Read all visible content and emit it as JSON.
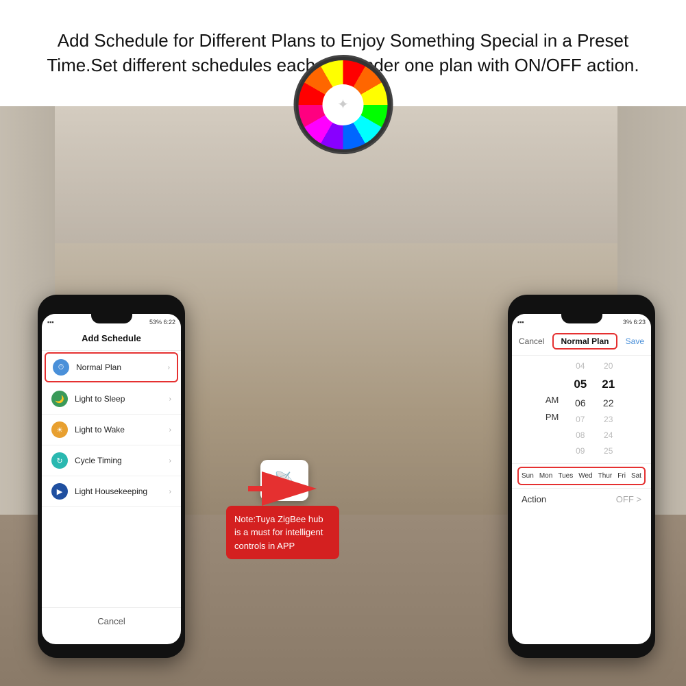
{
  "header": {
    "text": "Add Schedule for Different Plans to Enjoy Something Special in a Preset Time.Set different schedules each day under one plan with ON/OFF action."
  },
  "left_phone": {
    "status": "53%  6:22",
    "screen_title": "Add Schedule",
    "items": [
      {
        "id": "normal-plan",
        "icon": "clock",
        "icon_color": "blue",
        "label": "Normal Plan",
        "highlighted": true
      },
      {
        "id": "light-to-sleep",
        "icon": "moon",
        "icon_color": "green",
        "label": "Light to Sleep",
        "highlighted": false
      },
      {
        "id": "light-to-wake",
        "icon": "sun",
        "icon_color": "orange",
        "label": "Light to Wake",
        "highlighted": false
      },
      {
        "id": "cycle-timing",
        "icon": "cycle",
        "icon_color": "teal",
        "label": "Cycle Timing",
        "highlighted": false
      },
      {
        "id": "light-housekeeping",
        "icon": "volume",
        "icon_color": "navy",
        "label": "Light Housekeeping",
        "highlighted": false
      }
    ],
    "cancel": "Cancel"
  },
  "right_phone": {
    "status": "3%  6:23",
    "cancel_label": "Cancel",
    "plan_title": "Normal Plan",
    "save_label": "Save",
    "time_columns": {
      "ampm": [
        "AM",
        "PM"
      ],
      "hours": [
        "04",
        "05",
        "06",
        "07",
        "08",
        "09"
      ],
      "minutes": [
        "20",
        "21",
        "22",
        "23",
        "24",
        "25"
      ]
    },
    "days": [
      "Sun",
      "Mon",
      "Tues",
      "Wed",
      "Thur",
      "Fri",
      "Sat"
    ],
    "action_label": "Action",
    "action_value": "OFF >"
  },
  "note": {
    "text": "Note:Tuya ZigBee hub is a must for intelligent controls in APP"
  },
  "colors": {
    "accent_red": "#e53030",
    "accent_blue": "#4a90d9"
  }
}
